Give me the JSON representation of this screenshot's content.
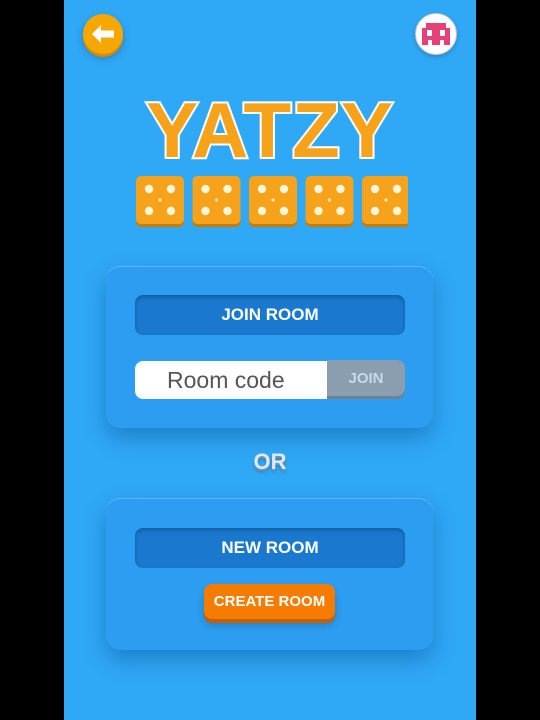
{
  "app": {
    "title": "YATZY"
  },
  "icons": {
    "back": "arrow-left-icon",
    "profile": "pixel-avatar-icon",
    "dice": "die-four-face-icon"
  },
  "dice": {
    "count": 5,
    "face_value": 4
  },
  "join_section": {
    "label": "JOIN ROOM",
    "input_placeholder": "Room code",
    "input_value": "",
    "join_button": "JOIN"
  },
  "divider": {
    "text": "OR"
  },
  "new_section": {
    "label": "NEW ROOM",
    "create_button": "CREATE ROOM"
  },
  "colors": {
    "background": "#2fa8f6",
    "card": "#2c9df0",
    "label_bar": "#1a79cf",
    "accent_orange": "#f57c00",
    "logo_orange": "#f7a21b",
    "die_orange": "#f7a21b",
    "join_disabled": "#8b9eb0"
  }
}
